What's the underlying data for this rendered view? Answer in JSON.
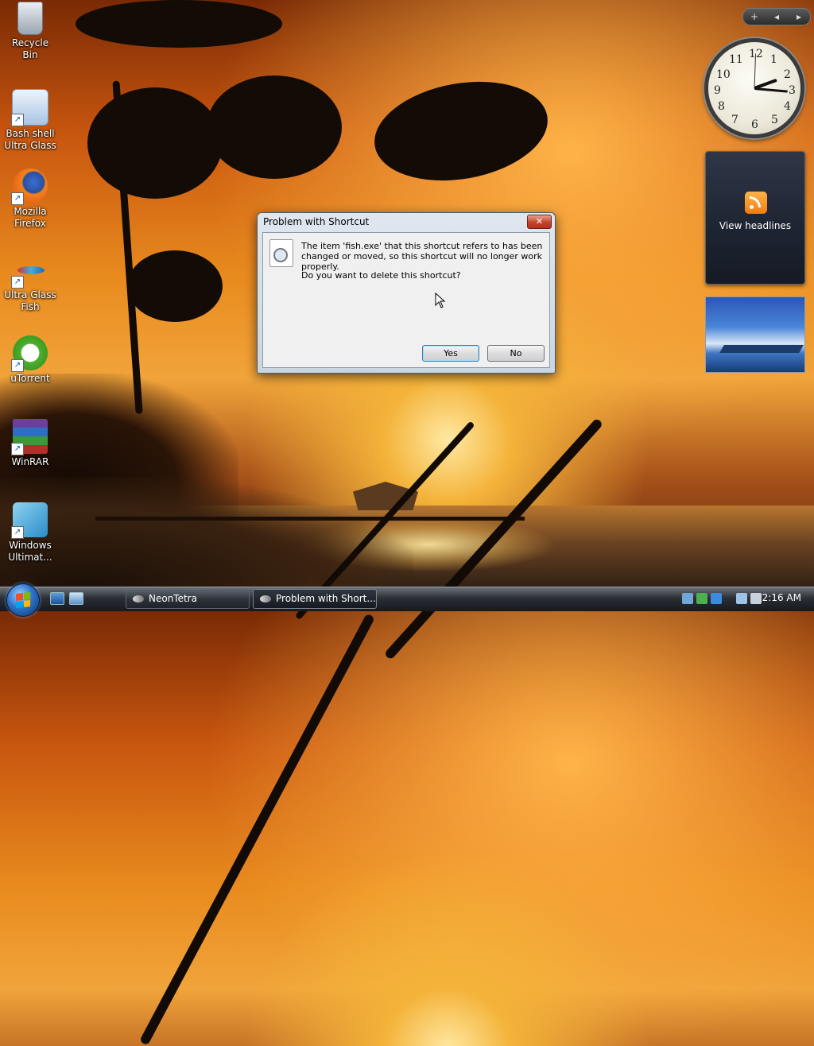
{
  "desktop": {
    "icons": [
      {
        "label": "Recycle Bin"
      },
      {
        "label": "Bash shell Ultra Glass"
      },
      {
        "label": "Mozilla Firefox"
      },
      {
        "label": "Ultra Glass Fish"
      },
      {
        "label": "uTorrent"
      },
      {
        "label": "WinRAR"
      },
      {
        "label": "Windows Ultimat..."
      }
    ]
  },
  "sidebar": {
    "controls": [
      "+",
      "◂",
      "▸"
    ],
    "clock": {
      "numerals": [
        "12",
        "1",
        "2",
        "3",
        "4",
        "5",
        "6",
        "7",
        "8",
        "9",
        "10",
        "11"
      ],
      "time_shown": "2:16"
    },
    "feed_gadget_label": "View headlines"
  },
  "dialog": {
    "title": "Problem with Shortcut",
    "close_label": "✕",
    "message": "The item 'fish.exe' that this shortcut refers to has been changed or moved, so this shortcut will no longer work properly.",
    "question": "Do you want to delete this shortcut?",
    "yes_label": "Yes",
    "no_label": "No"
  },
  "taskbar": {
    "tasks": [
      {
        "label": "NeonTetra"
      },
      {
        "label": "Problem with Short..."
      }
    ],
    "clock": "2:16 AM"
  },
  "colors": {
    "dialog_frame": "#c9d6e2",
    "close_button": "#c7432a",
    "taskbar": "#15181d",
    "rss": "#f07e12"
  }
}
